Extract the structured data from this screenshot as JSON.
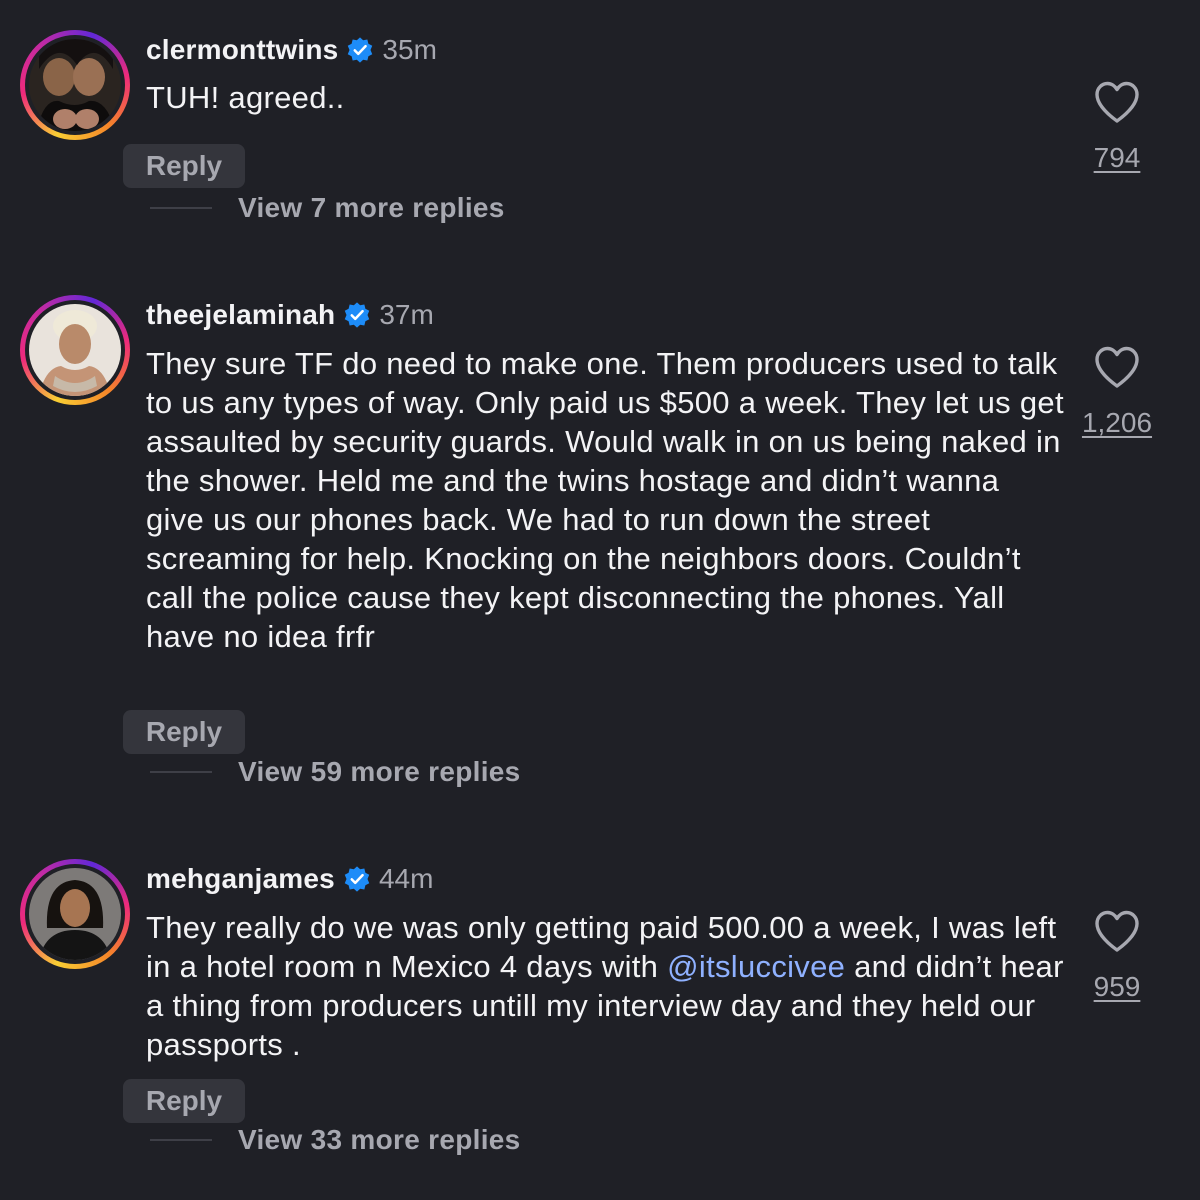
{
  "comments": [
    {
      "username": "clermonttwins",
      "verified": true,
      "time": "35m",
      "text": "TUH! agreed..",
      "reply_label": "Reply",
      "view_replies": "View 7 more replies",
      "likes": "794"
    },
    {
      "username": "theejelaminah",
      "verified": true,
      "time": "37m",
      "text": "They sure TF do need to make one. Them producers used to talk to us any types of way. Only paid us $500 a week. They let us get assaulted by security guards. Would walk in on us being naked in the shower. Held me and the twins hostage and didn’t wanna give us our phones back. We had to run down the street screaming for help. Knocking on the neighbors doors. Couldn’t call the police cause they kept disconnecting the phones. Yall have no idea frfr",
      "reply_label": "Reply",
      "view_replies": "View 59 more replies",
      "likes": "1,206"
    },
    {
      "username": "mehganjames",
      "verified": true,
      "time": "44m",
      "text_before": "They really do we was only getting paid 500.00 a week, I was left in a hotel room n Mexico 4 days with ",
      "mention": "@itsluccivee",
      "text_after": "  and didn’t hear a thing from producers untill my interview day  and they held our passports .",
      "reply_label": "Reply",
      "view_replies": "View 33 more replies",
      "likes": "959"
    }
  ],
  "colors": {
    "background": "#1f2026",
    "text": "#f3f3f5",
    "secondary": "#a7a8b0",
    "verified": "#1d8cf8",
    "mention": "#8fb1ff"
  }
}
